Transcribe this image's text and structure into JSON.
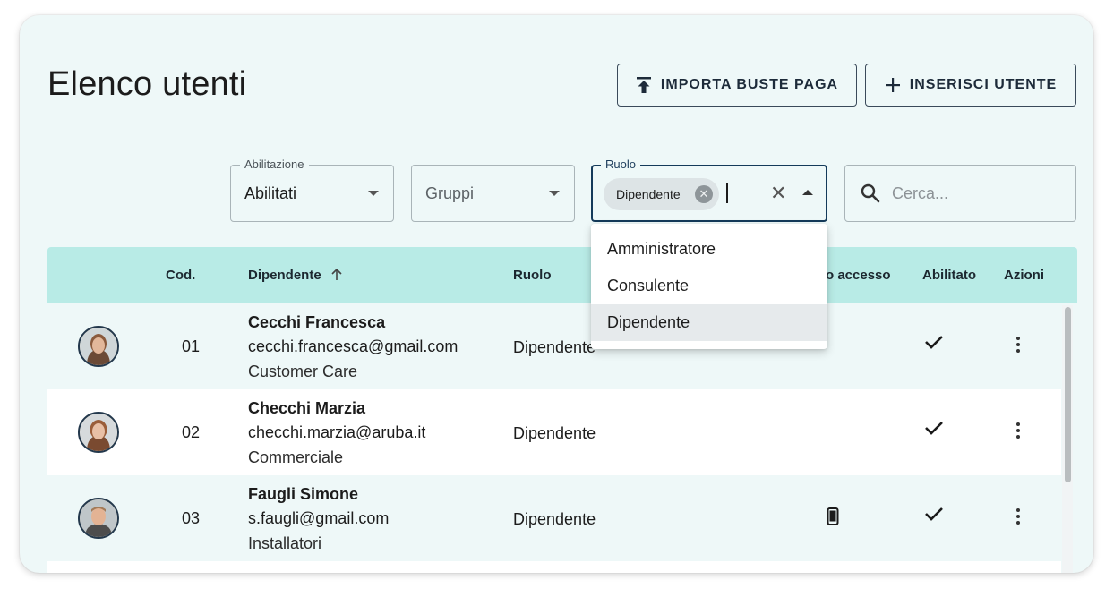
{
  "page": {
    "title": "Elenco utenti"
  },
  "toolbar": {
    "import_label": "IMPORTA BUSTE PAGA",
    "add_label": "INSERISCI UTENTE"
  },
  "filters": {
    "abilitazione": {
      "label": "Abilitazione",
      "value": "Abilitati"
    },
    "gruppi": {
      "placeholder": "Gruppi"
    },
    "ruolo": {
      "label": "Ruolo",
      "chip": "Dipendente"
    },
    "search": {
      "placeholder": "Cerca..."
    }
  },
  "table": {
    "headers": {
      "cod": "Cod.",
      "dipendente": "Dipendente",
      "ruolo": "Ruolo",
      "accesso": "o accesso",
      "abilitato": "Abilitato",
      "azioni": "Azioni"
    },
    "rows": [
      {
        "cod": "01",
        "name": "Cecchi Francesca",
        "email": "cecchi.francesca@gmail.com",
        "dept": "Customer Care",
        "ruolo": "Dipendente",
        "abilitato": true,
        "mobile_access": false
      },
      {
        "cod": "02",
        "name": "Checchi Marzia",
        "email": "checchi.marzia@aruba.it",
        "dept": "Commerciale",
        "ruolo": "Dipendente",
        "abilitato": true,
        "mobile_access": false
      },
      {
        "cod": "03",
        "name": "Faugli Simone",
        "email": "s.faugli@gmail.com",
        "dept": "Installatori",
        "ruolo": "Dipendente",
        "abilitato": true,
        "mobile_access": true
      }
    ]
  },
  "dropdown": {
    "options": [
      "Amministratore",
      "Consulente",
      "Dipendente"
    ],
    "selected": "Dipendente"
  },
  "icons": {
    "import": "upload-icon",
    "add": "plus-icon",
    "search": "search-icon",
    "sort": "arrow-up-icon",
    "check": "check-icon",
    "more": "kebab-menu-icon",
    "phone": "smartphone-icon"
  },
  "colors": {
    "card_bg": "#eef8f8",
    "header_bg": "#b8ebe6",
    "accent": "#143a5a"
  }
}
